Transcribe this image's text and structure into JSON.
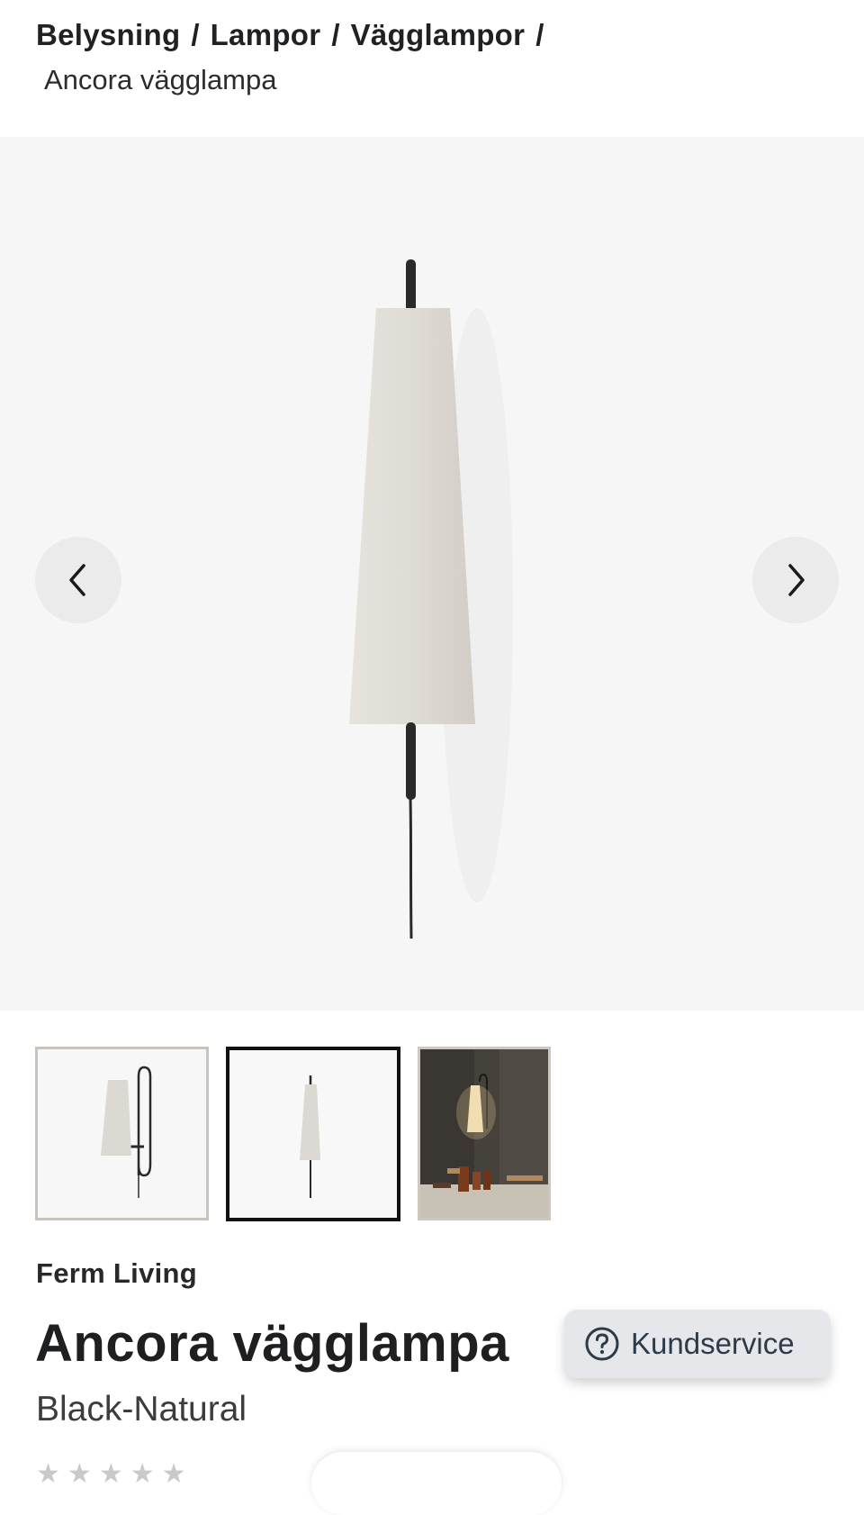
{
  "breadcrumb": {
    "items": [
      "Belysning",
      "Lampor",
      "Vägglampor"
    ],
    "separator": "/",
    "current": "Ancora vägglampa"
  },
  "gallery": {
    "prev_icon": "chevron-left-icon",
    "next_icon": "chevron-right-icon",
    "selected_thumbnail": 2,
    "thumbnail_count": 3
  },
  "product": {
    "brand": "Ferm Living",
    "title": "Ancora vägglampa",
    "variant": "Black-Natural",
    "rating_stars": 5
  },
  "support": {
    "label": "Kundservice",
    "icon": "help-circle-icon"
  },
  "colors": {
    "gallery_bg": "#f6f6f6",
    "shade": "#e0dcd6",
    "stem": "#2a2a2a",
    "support_bg": "#e5e7ea",
    "support_text": "#2d3a48"
  }
}
